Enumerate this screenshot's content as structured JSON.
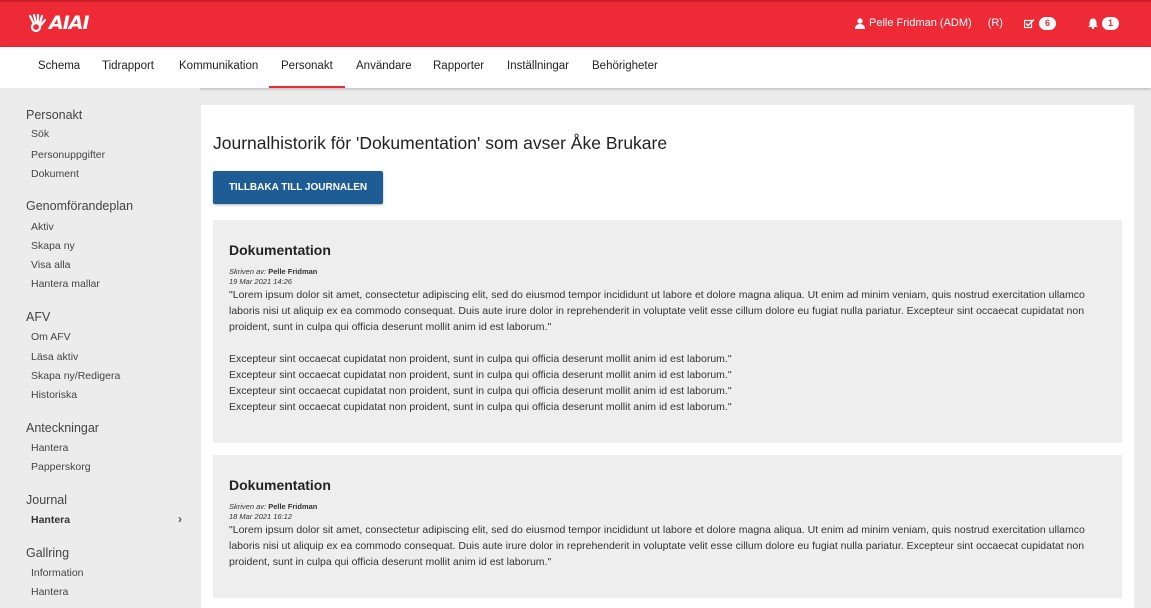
{
  "header": {
    "logo_text": "AIAI",
    "user_name": "Pelle Fridman (ADM)",
    "user_role": "(R)",
    "tasks_count": "6",
    "notifications_count": "1",
    "accent_color": "#ee2a36"
  },
  "nav": {
    "items": [
      "Schema",
      "Tidrapport",
      "Kommunikation",
      "Personakt",
      "Användare",
      "Rapporter",
      "Inställningar",
      "Behörigheter"
    ],
    "active": "Personakt"
  },
  "sidebar": {
    "sections": [
      {
        "title": "Personakt",
        "items": [
          "Sök",
          "Personuppgifter",
          "Dokument"
        ]
      },
      {
        "title": "Genomförandeplan",
        "items": [
          "Aktiv",
          "Skapa ny",
          "Visa alla",
          "Hantera mallar"
        ]
      },
      {
        "title": "AFV",
        "items": [
          "Om AFV",
          "Läsa aktiv",
          "Skapa ny/Redigera",
          "Historiska"
        ]
      },
      {
        "title": "Anteckningar",
        "items": [
          "Hantera",
          "Papperskorg"
        ]
      },
      {
        "title": "Journal",
        "items": [
          "Hantera"
        ]
      },
      {
        "title": "Gallring",
        "items": [
          "Information",
          "Hantera"
        ]
      }
    ]
  },
  "main": {
    "title": "Journalhistorik för 'Dokumentation' som avser Åke Brukare",
    "back_button": "Tillbaka till journalen",
    "entries": [
      {
        "title": "Dokumentation",
        "written_by_label": "Skriven av:",
        "author": "Pelle Fridman",
        "date": "19 Mar 2021 14:26",
        "text": "\"Lorem ipsum dolor sit amet, consectetur adipiscing elit, sed do eiusmod tempor incididunt ut labore et dolore magna aliqua. Ut enim ad minim veniam, quis nostrud exercitation ullamco laboris nisi ut aliquip ex ea commodo consequat. Duis aute irure dolor in reprehenderit in voluptate velit esse cillum dolore eu fugiat nulla pariatur. Excepteur sint occaecat cupidatat non proident, sunt in culpa qui officia deserunt mollit anim id est laborum.\"\n\nExcepteur sint occaecat cupidatat non proident, sunt in culpa qui officia deserunt mollit anim id est laborum.\"\nExcepteur sint occaecat cupidatat non proident, sunt in culpa qui officia deserunt mollit anim id est laborum.\"\nExcepteur sint occaecat cupidatat non proident, sunt in culpa qui officia deserunt mollit anim id est laborum.\"\nExcepteur sint occaecat cupidatat non proident, sunt in culpa qui officia deserunt mollit anim id est laborum.\""
      },
      {
        "title": "Dokumentation",
        "written_by_label": "Skriven av:",
        "author": "Pelle Fridman",
        "date": "18 Mar 2021 16:12",
        "text": "\"Lorem ipsum dolor sit amet, consectetur adipiscing elit, sed do eiusmod tempor incididunt ut labore et dolore magna aliqua. Ut enim ad minim veniam, quis nostrud exercitation ullamco laboris nisi ut aliquip ex ea commodo consequat. Duis aute irure dolor in reprehenderit in voluptate velit esse cillum dolore eu fugiat nulla pariatur. Excepteur sint occaecat cupidatat non proident, sunt in culpa qui officia deserunt mollit anim id est laborum.\""
      }
    ]
  }
}
